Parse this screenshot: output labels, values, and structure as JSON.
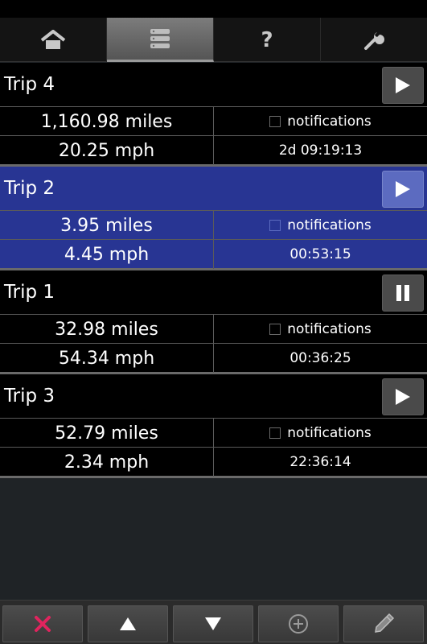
{
  "tabs": [
    {
      "icon": "home-icon",
      "active": false
    },
    {
      "icon": "list-icon",
      "active": true
    },
    {
      "icon": "help-icon",
      "label": "?",
      "active": false
    },
    {
      "icon": "wrench-icon",
      "active": false
    }
  ],
  "trips": [
    {
      "name": "Trip 4",
      "distance": "1,160.98 miles",
      "speed": "20.25 mph",
      "notifications_label": "notifications",
      "duration": "2d 09:19:13",
      "button": "play-icon",
      "selected": false
    },
    {
      "name": "Trip 2",
      "distance": "3.95 miles",
      "speed": "4.45 mph",
      "notifications_label": "notifications",
      "duration": "00:53:15",
      "button": "play-icon",
      "selected": true
    },
    {
      "name": "Trip 1",
      "distance": "32.98 miles",
      "speed": "54.34 mph",
      "notifications_label": "notifications",
      "duration": "00:36:25",
      "button": "pause-icon",
      "selected": false
    },
    {
      "name": "Trip 3",
      "distance": "52.79 miles",
      "speed": "2.34 mph",
      "notifications_label": "notifications",
      "duration": "22:36:14",
      "button": "play-icon",
      "selected": false
    }
  ],
  "toolbar": [
    {
      "icon": "delete-icon"
    },
    {
      "icon": "move-up-icon"
    },
    {
      "icon": "move-down-icon"
    },
    {
      "icon": "add-icon"
    },
    {
      "icon": "edit-icon"
    }
  ],
  "colors": {
    "selected_row": "#283593",
    "delete_red": "#e0245e",
    "active_tab": "#6e6e6e"
  }
}
